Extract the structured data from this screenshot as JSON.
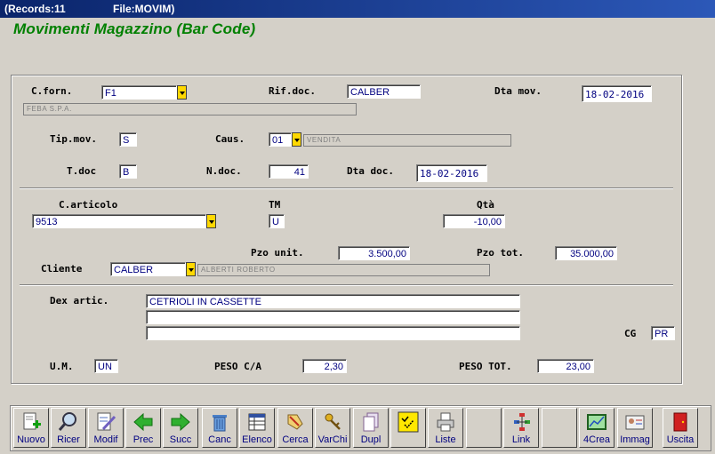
{
  "window": {
    "records": "(Records:11",
    "file": "File:MOVIM)"
  },
  "app_title": "Movimenti Magazzino (Bar Code)",
  "form": {
    "cforn_label": "C.forn.",
    "cforn_value": "F1",
    "cforn_desc": "FEBA S.P.A.",
    "rifdoc_label": "Rif.doc.",
    "rifdoc_value": "CALBER",
    "dtamov_label": "Dta mov.",
    "dtamov_value": "18-02-2016",
    "tipmov_label": "Tip.mov.",
    "tipmov_value": "S",
    "caus_label": "Caus.",
    "caus_value": "01",
    "caus_desc": "VENDITA",
    "tdoc_label": "T.doc",
    "tdoc_value": "B",
    "ndoc_label": "N.doc.",
    "ndoc_value": "41",
    "dtadoc_label": "Dta doc.",
    "dtadoc_value": "18-02-2016",
    "carticolo_label": "C.articolo",
    "carticolo_value": "9513",
    "tm_label": "TM",
    "tm_value": "U",
    "qta_label": "Qtà",
    "qta_value": "-10,00",
    "pzounit_label": "Pzo unit.",
    "pzounit_value": "3.500,00",
    "pzotot_label": "Pzo tot.",
    "pzotot_value": "35.000,00",
    "cliente_label": "Cliente",
    "cliente_value": "CALBER",
    "cliente_desc": "ALBERTI ROBERTO",
    "dexartic_label": "Dex artic.",
    "dexartic_line1": "CETRIOLI IN CASSETTE",
    "dexartic_line2": "",
    "dexartic_line3": "",
    "cg_label": "CG",
    "cg_value": "PR",
    "um_label": "U.M.",
    "um_value": "UN",
    "pesoca_label": "PESO C/A",
    "pesoca_value": "2,30",
    "pesotot_label": "PESO TOT.",
    "pesotot_value": "23,00"
  },
  "toolbar": {
    "nuovo": "Nuovo",
    "ricer": "Ricer",
    "modif": "Modif",
    "prec": "Prec",
    "succ": "Succ",
    "canc": "Canc",
    "elenco": "Elenco",
    "cerca": "Cerca",
    "varchi": "VarChi",
    "dupl": "Dupl",
    "liste": "Liste",
    "link": "Link",
    "crea4": "4Crea",
    "immag": "Immag",
    "uscita": "Uscita"
  },
  "icons": {
    "nuovo": "new-document-icon",
    "ricer": "magnifier-icon",
    "modif": "edit-document-icon",
    "prec": "green-left-arrow-icon",
    "succ": "green-right-arrow-icon",
    "canc": "trash-can-icon",
    "elenco": "list-table-icon",
    "cerca": "search-hand-icon",
    "varchi": "keys-icon",
    "dupl": "duplicate-pages-icon",
    "check": "check-list-icon",
    "liste": "printer-icon",
    "link": "link-tree-icon",
    "crea4": "chart-frame-icon",
    "immag": "id-card-icon",
    "uscita": "red-door-exit-icon"
  },
  "colors": {
    "title": "#008000",
    "field_text": "#000080",
    "dropdown": "#ffd800",
    "titlebar": "#0a246a"
  }
}
